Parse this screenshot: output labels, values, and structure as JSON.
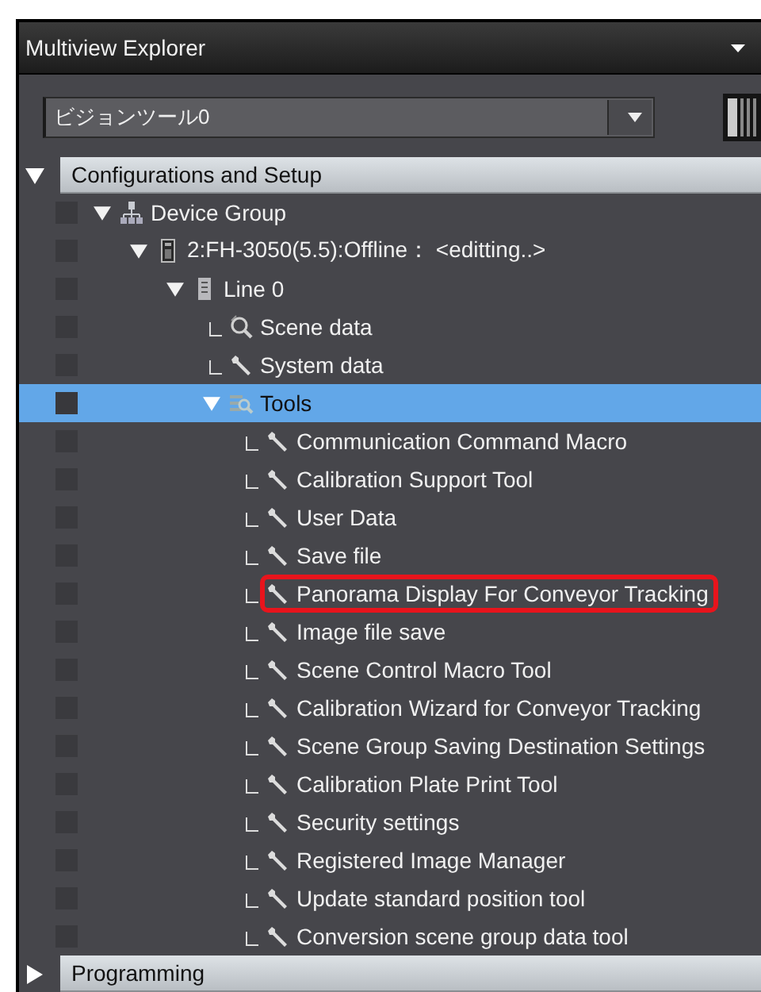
{
  "panel": {
    "title": "Multiview Explorer"
  },
  "device_select": {
    "value": "ビジョンツール0"
  },
  "sections": [
    {
      "label": "Configurations and Setup",
      "expanded": true,
      "tree": [
        {
          "label": "Device Group",
          "kind": "group",
          "expanded": true,
          "selected": false,
          "children": [
            {
              "label": "2:FH-3050(5.5):Offline： <editting..>",
              "kind": "controller",
              "expanded": true,
              "selected": false,
              "children": [
                {
                  "label": "Line 0",
                  "kind": "line",
                  "expanded": true,
                  "selected": false,
                  "children": [
                    {
                      "label": "Scene data",
                      "kind": "scene",
                      "selected": false
                    },
                    {
                      "label": "System data",
                      "kind": "wrench",
                      "selected": false
                    },
                    {
                      "label": "Tools",
                      "kind": "tools",
                      "expanded": true,
                      "selected": true,
                      "children": [
                        {
                          "label": "Communication Command Macro",
                          "kind": "wrench",
                          "selected": false,
                          "highlighted": false
                        },
                        {
                          "label": "Calibration Support Tool",
                          "kind": "wrench",
                          "selected": false,
                          "highlighted": false
                        },
                        {
                          "label": "User Data",
                          "kind": "wrench",
                          "selected": false,
                          "highlighted": false
                        },
                        {
                          "label": "Save file",
                          "kind": "wrench",
                          "selected": false,
                          "highlighted": false
                        },
                        {
                          "label": "Panorama Display For Conveyor Tracking",
                          "kind": "wrench",
                          "selected": false,
                          "highlighted": true
                        },
                        {
                          "label": "Image file save",
                          "kind": "wrench",
                          "selected": false,
                          "highlighted": false
                        },
                        {
                          "label": "Scene Control Macro Tool",
                          "kind": "wrench",
                          "selected": false,
                          "highlighted": false
                        },
                        {
                          "label": "Calibration Wizard for Conveyor Tracking",
                          "kind": "wrench",
                          "selected": false,
                          "highlighted": false
                        },
                        {
                          "label": "Scene Group Saving Destination Settings",
                          "kind": "wrench",
                          "selected": false,
                          "highlighted": false
                        },
                        {
                          "label": "Calibration Plate Print Tool",
                          "kind": "wrench",
                          "selected": false,
                          "highlighted": false
                        },
                        {
                          "label": "Security settings",
                          "kind": "wrench",
                          "selected": false,
                          "highlighted": false
                        },
                        {
                          "label": "Registered Image Manager",
                          "kind": "wrench",
                          "selected": false,
                          "highlighted": false
                        },
                        {
                          "label": "Update standard position tool",
                          "kind": "wrench",
                          "selected": false,
                          "highlighted": false
                        },
                        {
                          "label": "Conversion scene group data tool",
                          "kind": "wrench",
                          "selected": false,
                          "highlighted": false
                        }
                      ]
                    }
                  ]
                }
              ]
            }
          ]
        }
      ]
    },
    {
      "label": "Programming",
      "expanded": false
    }
  ]
}
